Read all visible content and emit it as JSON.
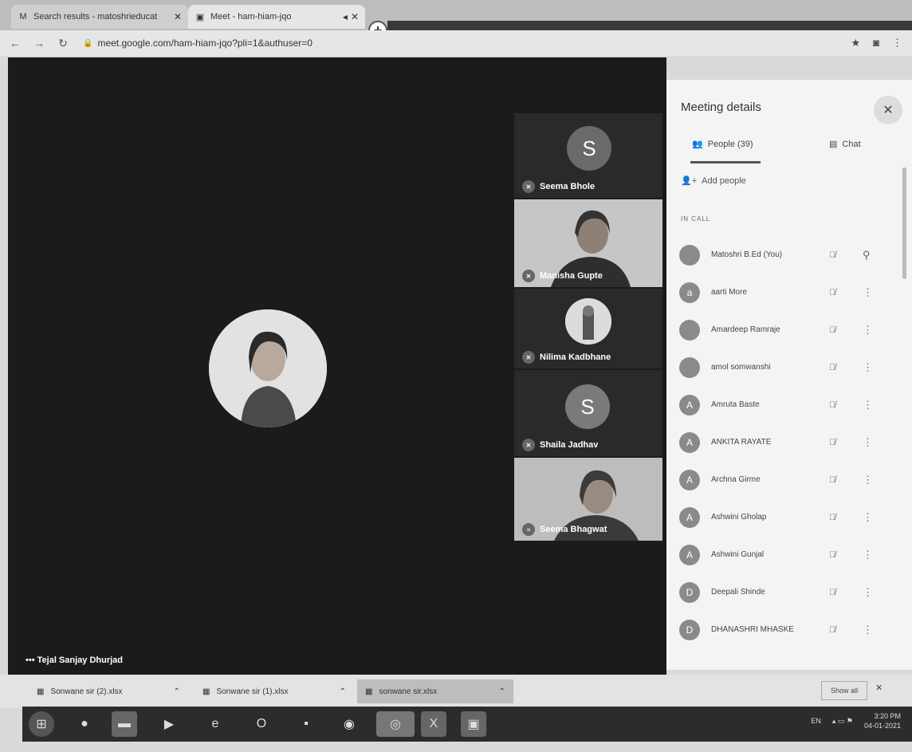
{
  "browser": {
    "tabs": [
      {
        "title": "Search results - matoshrieducat",
        "icon": "gmail-icon"
      },
      {
        "title": "Meet - ham-hiam-jqo",
        "icon": "meet-icon"
      }
    ],
    "url": "meet.google.com/ham-hiam-jqo?pli=1&authuser=0"
  },
  "stage": {
    "main_name": "Tejal Sanjay Dhurjad",
    "tiles": [
      {
        "name": "Seema Bhole",
        "letter": "S"
      },
      {
        "name": "Manisha Gupte"
      },
      {
        "name": "Nilima Kadbhane"
      },
      {
        "name": "Shaila Jadhav",
        "letter": "S"
      },
      {
        "name": "Seema Bhagwat"
      }
    ]
  },
  "panel": {
    "title": "Meeting details",
    "people_tab": "People (39)",
    "chat_tab": "Chat",
    "add_people": "Add people",
    "in_call": "IN CALL",
    "participants": [
      {
        "name": "Matoshri B.Ed (You)",
        "initial": ""
      },
      {
        "name": "aarti More",
        "initial": "a"
      },
      {
        "name": "Amardeep Ramraje",
        "initial": ""
      },
      {
        "name": "amol somwanshi",
        "initial": ""
      },
      {
        "name": "Amruta Baste",
        "initial": "A"
      },
      {
        "name": "ANKITA RAYATE",
        "initial": "A"
      },
      {
        "name": "Archna Girme",
        "initial": "A"
      },
      {
        "name": "Ashwini Gholap",
        "initial": "A"
      },
      {
        "name": "Ashwini Gunjal",
        "initial": "A"
      },
      {
        "name": "Deepali Shinde",
        "initial": "D"
      },
      {
        "name": "DHANASHRI MHASKE",
        "initial": "D"
      }
    ]
  },
  "downloads": {
    "items": [
      {
        "name": "Sonwane sir (2).xlsx"
      },
      {
        "name": "Sonwane sir (1).xlsx"
      },
      {
        "name": "sonwane sir.xlsx"
      }
    ],
    "show_all": "Show all"
  },
  "taskbar": {
    "lang": "EN",
    "time": "3:20 PM",
    "date": "04-01-2021"
  }
}
